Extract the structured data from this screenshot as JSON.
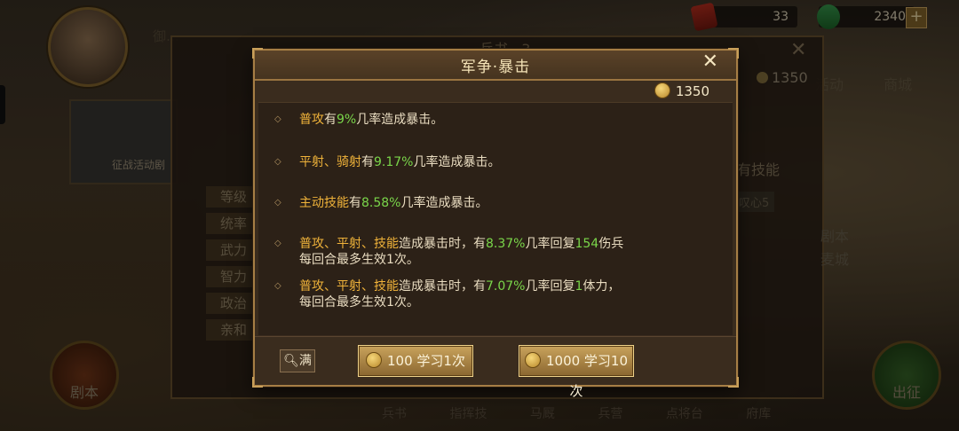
{
  "top_bar": {
    "res1_value": "33",
    "res2_value": "2340",
    "plus": "+"
  },
  "background": {
    "tab_label": "御…",
    "under_title": "兵书 · 3",
    "under_gold": "1350",
    "battle_label": "征战活动剧",
    "stats": [
      "等级",
      "统率",
      "武力",
      "智力",
      "政治",
      "亲和"
    ],
    "skill_text": "有技能",
    "heart_badge": "叹心5",
    "right_menu": [
      "活动",
      "商城"
    ],
    "right_side": [
      "剧本",
      "麦城"
    ],
    "left_round_label": "剧本",
    "right_round_label": "出征",
    "bottom_nav": [
      "兵书",
      "指挥技",
      "马厩",
      "兵营",
      "点将台",
      "府库"
    ]
  },
  "modal": {
    "title": "军争·暴击",
    "close": "✕",
    "gold": "1350",
    "entries": [
      {
        "a": "普攻",
        "b": "有",
        "c": "9%",
        "d": "几率造成暴击。"
      },
      {
        "a": "平射、骑射",
        "b": "有",
        "c": "9.17%",
        "d": "几率造成暴击。"
      },
      {
        "a": "主动技能",
        "b": "有",
        "c": "8.58%",
        "d": "几率造成暴击。"
      },
      {
        "a": "普攻、平射、技能",
        "b": "造成暴击时，有",
        "c": "8.37%",
        "d": "几率回复",
        "e": "154",
        "f": "伤兵",
        "line2": "每回合最多生效1次。"
      },
      {
        "a": "普攻、平射、技能",
        "b": "造成暴击时，有",
        "c": "7.07%",
        "d": "几率回复",
        "e": "1",
        "f": "体力，",
        "line2": "每回合最多生效1次。"
      }
    ],
    "max_btn": "满",
    "learn1": "100 学习1次",
    "learn10": "1000 学习10次"
  }
}
